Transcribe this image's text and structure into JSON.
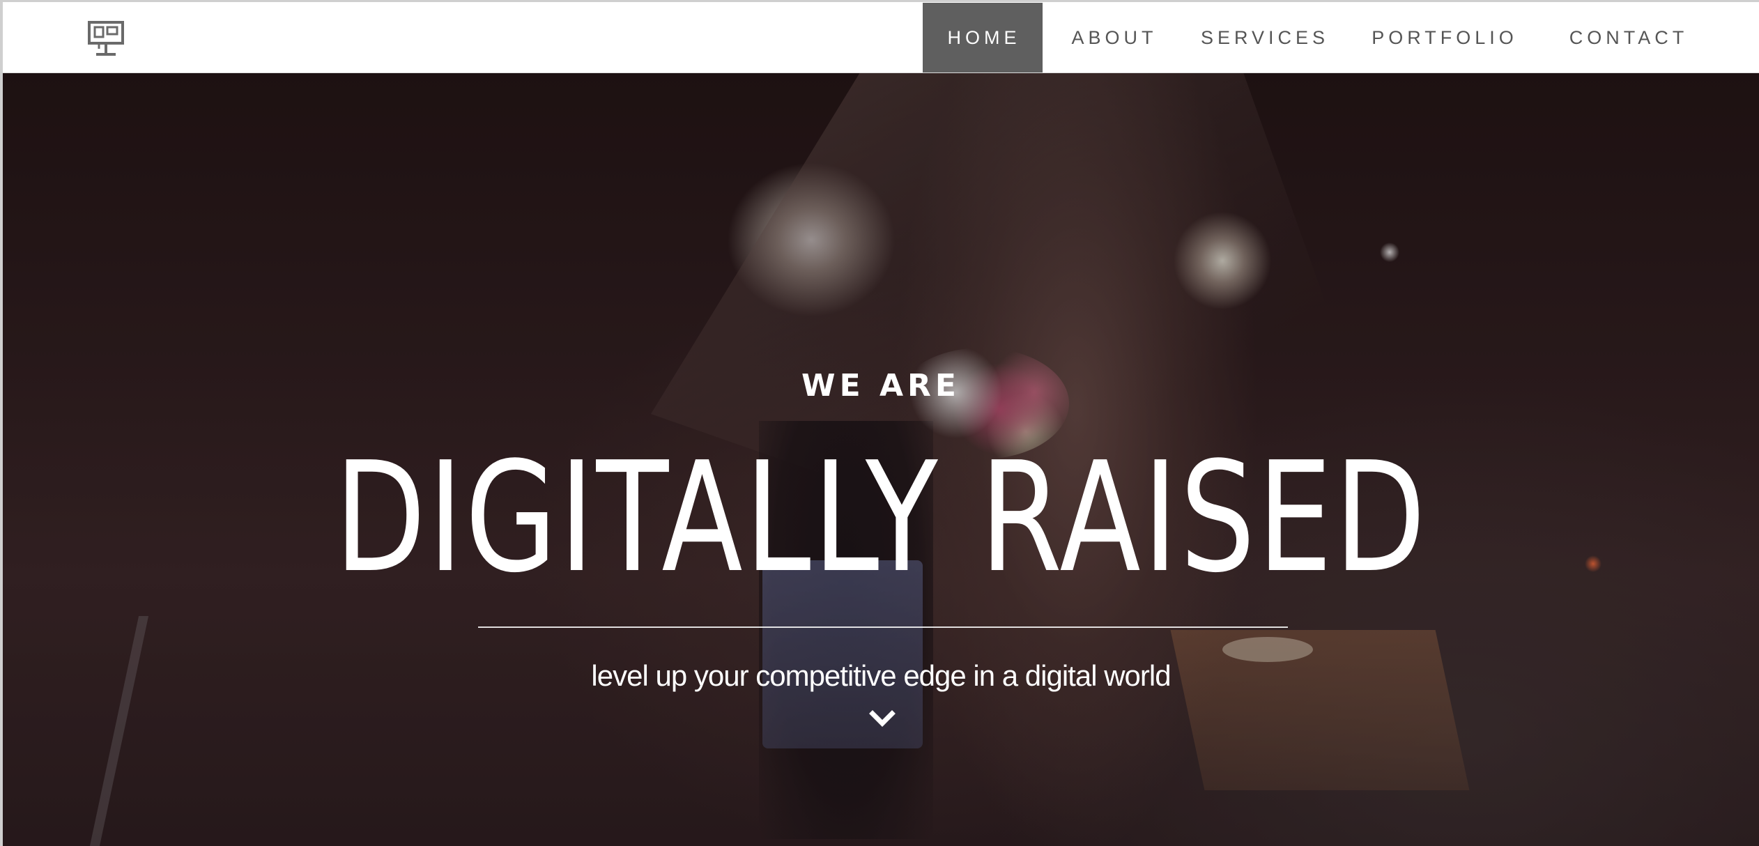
{
  "header": {
    "logo_icon": "monitor-network-icon",
    "nav": [
      {
        "label": "HOME",
        "active": true
      },
      {
        "label": "ABOUT",
        "active": false
      },
      {
        "label": "SERVICES",
        "active": false
      },
      {
        "label": "PORTFOLIO",
        "active": false
      },
      {
        "label": "CONTACT",
        "active": false
      }
    ],
    "active_bg": "#5f5f5f"
  },
  "hero": {
    "eyebrow": "WE ARE",
    "headline": "DIGITALLY RAISED",
    "tagline": "level up your competitive edge in a digital world",
    "scroll_icon": "chevron-down-icon"
  }
}
